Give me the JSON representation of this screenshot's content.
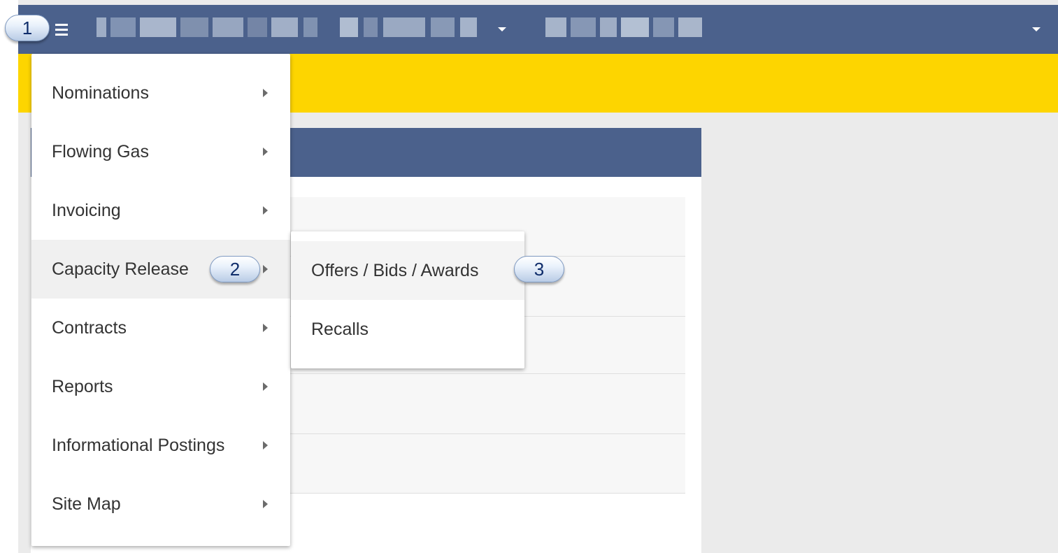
{
  "topbar": {
    "background": "#4b618c",
    "menu_icon": "hamburger-menu-icon",
    "dropdown_icon": "caret-down-icon",
    "selector_1": {
      "redacted": true
    },
    "selector_2": {
      "redacted": true
    }
  },
  "banner": {
    "color": "#fdd500"
  },
  "main_menu": {
    "items": [
      {
        "label": "Nominations"
      },
      {
        "label": "Flowing Gas"
      },
      {
        "label": "Invoicing"
      },
      {
        "label": "Capacity Release",
        "active": true
      },
      {
        "label": "Contracts"
      },
      {
        "label": "Reports"
      },
      {
        "label": "Informational Postings"
      },
      {
        "label": "Site Map"
      }
    ],
    "submenu_icon": "caret-right-icon"
  },
  "capacity_release_submenu": {
    "items": [
      {
        "label": "Offers / Bids / Awards",
        "active": true
      },
      {
        "label": "Recalls"
      }
    ]
  },
  "callouts": [
    "1",
    "2",
    "3"
  ]
}
